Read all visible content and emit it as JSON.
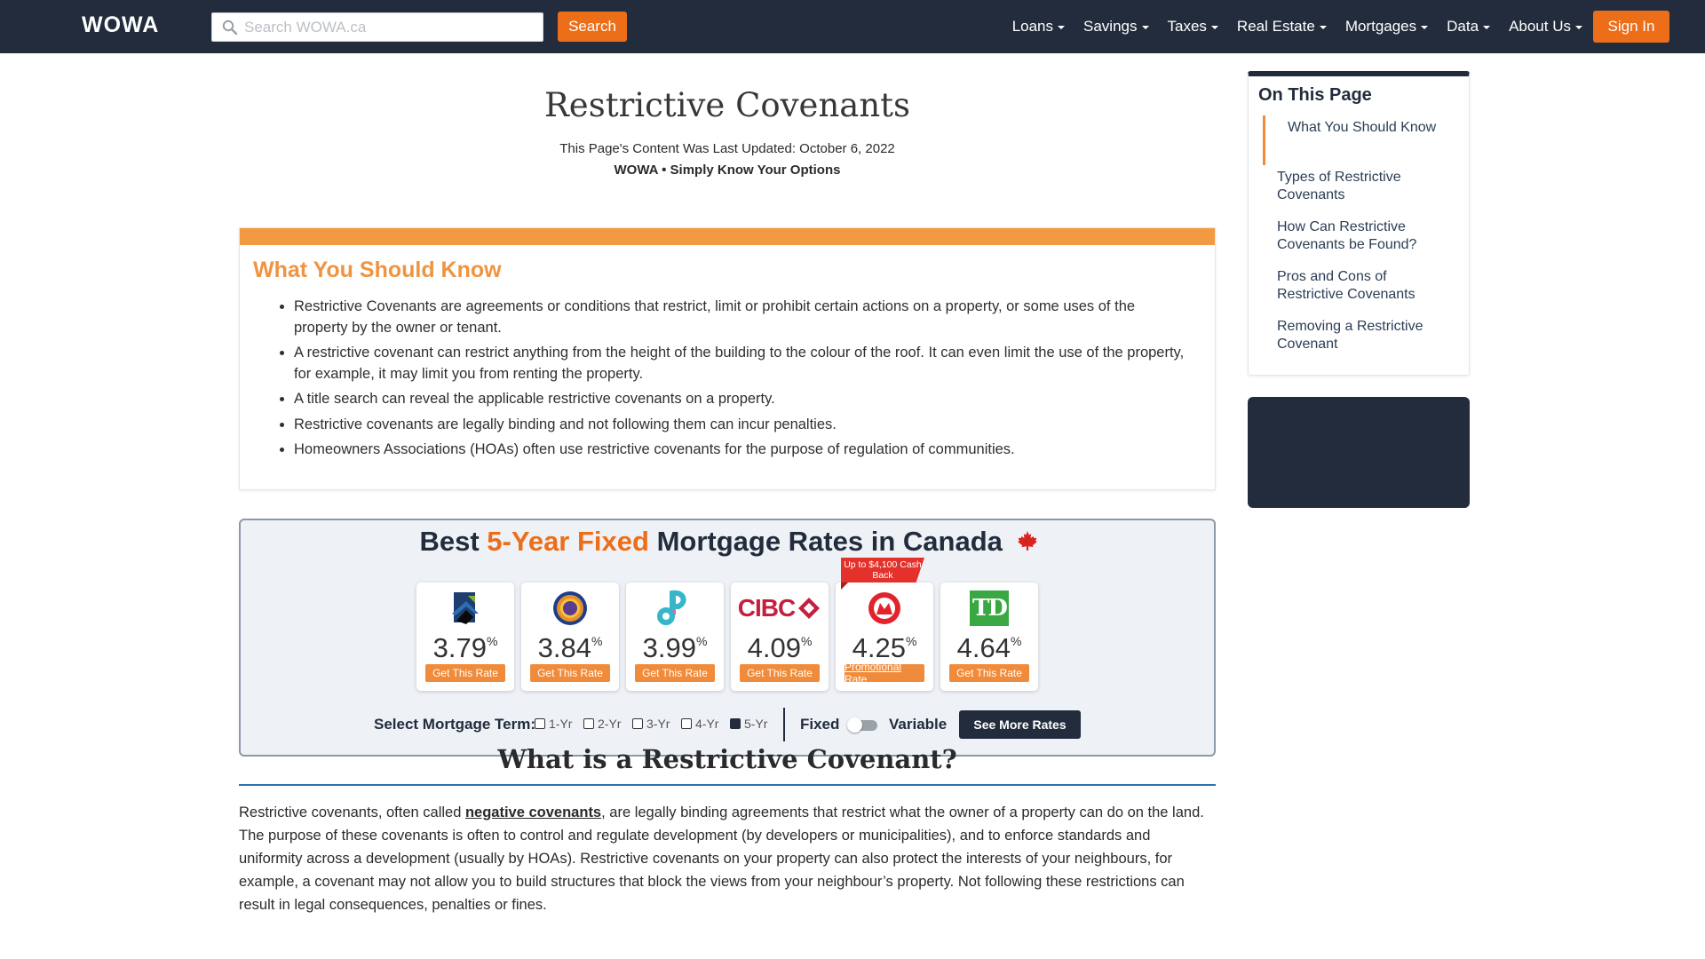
{
  "nav": {
    "logo": "WOWA",
    "search_placeholder": "Search WOWA.ca",
    "search_button": "Search",
    "menu": [
      "Loans",
      "Savings",
      "Taxes",
      "Real Estate",
      "Mortgages",
      "Data",
      "About Us"
    ],
    "sign_in": "Sign In"
  },
  "header": {
    "title": "Restrictive Covenants",
    "updated": "This Page's Content Was Last Updated: October 6, 2022",
    "tagline": "WOWA • Simply Know Your Options"
  },
  "know": {
    "title": "What You Should Know",
    "items": [
      "Restrictive Covenants are agreements or conditions that restrict, limit or prohibit certain actions on a property, or some uses of the property by the owner or tenant.",
      "A restrictive covenant can restrict anything from the height of the building to the colour of the roof. It can even limit the use of the property, for example, it may limit you from renting the property.",
      "A title search can reveal the applicable restrictive covenants on a property.",
      "Restrictive covenants are legally binding and not following them can incur penalties.",
      "Homeowners Associations (HOAs) often use restrictive covenants for the purpose of regulation of communities."
    ]
  },
  "rates": {
    "title_pre": "Best ",
    "title_highlight": "5-Year Fixed",
    "title_post": " Mortgage Rates in Canada",
    "percent": "%",
    "cards": [
      {
        "rate": "3.79",
        "button": "Get This Rate",
        "logo": "house-logo-icon"
      },
      {
        "rate": "3.84",
        "button": "Get This Rate",
        "logo": "ring-logo-icon"
      },
      {
        "rate": "3.99",
        "button": "Get This Rate",
        "logo": "p-logo-icon"
      },
      {
        "rate": "4.09",
        "button": "Get This Rate",
        "logo": "cibc-logo-icon",
        "logo_text": "CIBC"
      },
      {
        "rate": "4.25",
        "button": "Promotional Rate",
        "logo": "bmo-logo-icon",
        "badge": "Up to $4,100 Cash Back"
      },
      {
        "rate": "4.64",
        "button": "Get This Rate",
        "logo": "td-logo-icon",
        "logo_text": "TD"
      }
    ],
    "term_label": "Select Mortgage Term:",
    "terms": [
      "1-Yr",
      "2-Yr",
      "3-Yr",
      "4-Yr",
      "5-Yr"
    ],
    "selected_term": "5-Yr",
    "fixed_label": "Fixed",
    "variable_label": "Variable",
    "more_button": "See More Rates"
  },
  "section": {
    "heading": "What is a Restrictive Covenant?",
    "p_before": "Restrictive covenants, often called ",
    "link": "negative covenants",
    "p_after": ", are legally binding agreements that restrict what the owner of a property can do on the land. The purpose of these covenants is often to control and regulate development (by developers or municipalities), and to enforce standards and uniformity across a development (usually by HOAs). Restrictive covenants on your property can also protect the interests of your neighbours, for example, a covenant may not allow you to build structures that block the views from your neighbour’s property. Not following these restrictions can result in legal consequences, penalties or fines."
  },
  "toc": {
    "title": "On This Page",
    "items": [
      "What You Should Know",
      "Types of Restrictive Covenants",
      "How Can Restrictive Covenants be Found?",
      "Pros and Cons of Restrictive Covenants",
      "Removing a Restrictive Covenant"
    ]
  },
  "colors": {
    "nav_bg": "#222c3c",
    "accent_orange": "#ec6e18",
    "know_orange": "#f29a42",
    "link_blue": "#2f6fb4"
  }
}
